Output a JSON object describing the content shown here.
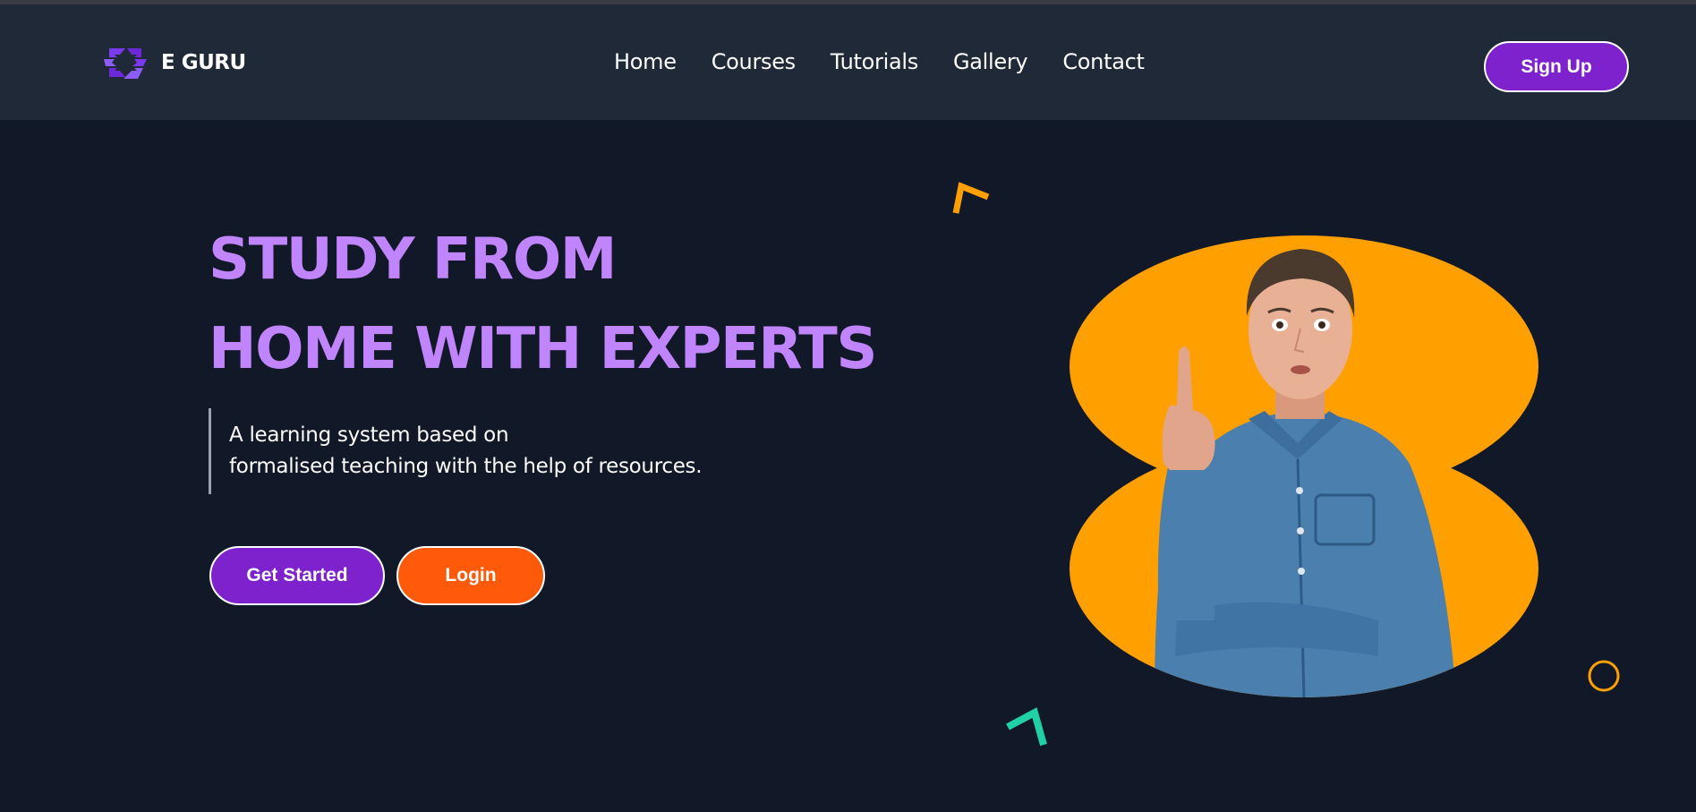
{
  "brand": {
    "name": "E GURU"
  },
  "nav": {
    "items": [
      {
        "label": "Home"
      },
      {
        "label": "Courses"
      },
      {
        "label": "Tutorials"
      },
      {
        "label": "Gallery"
      },
      {
        "label": "Contact"
      }
    ]
  },
  "header": {
    "signup_label": "Sign Up"
  },
  "hero": {
    "title_line1": "STUDY FROM",
    "title_line2": "HOME WITH EXPERTS",
    "desc_line1": "A learning system based on",
    "desc_line2": "formalised teaching with the help of resources.",
    "get_started_label": "Get Started",
    "login_label": "Login"
  },
  "colors": {
    "background": "#111827",
    "header": "#1f2937",
    "accent_purple": "#7e22ce",
    "title_purple": "#c084fc",
    "login_orange": "#ff5a0a",
    "blob_orange": "#ffa000",
    "deco_teal": "#1fd1a5"
  },
  "icons": {
    "logo": "eguru-logo-icon",
    "deco": [
      "orange-chevron-icon",
      "teal-chevron-icon",
      "orange-ring-icon"
    ]
  }
}
